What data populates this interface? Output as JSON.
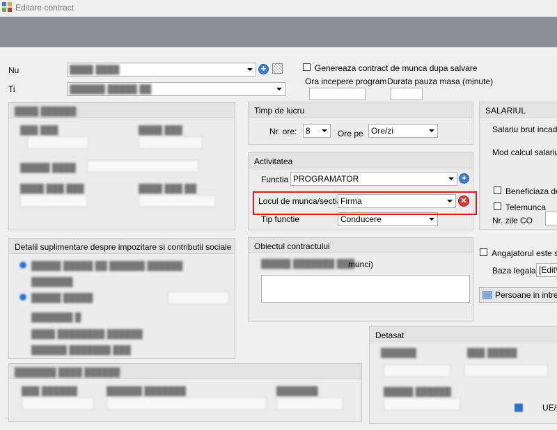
{
  "window": {
    "title": "Editare contract"
  },
  "top": {
    "name_label": "Nu",
    "type_label": "Ti",
    "generate_checkbox_label": "Genereaza contract de munca dupa salvare",
    "start_program_label": "Ora incepere program",
    "lunch_break_label": "Durata pauza masa (minute)",
    "start_program_value": "",
    "lunch_break_value": ""
  },
  "timp_lucru": {
    "title": "Timp de lucru",
    "hours_label": "Nr. ore:",
    "hours_value": "8",
    "per_label": "Ore pe",
    "per_value": "Ore/zi"
  },
  "activitatea": {
    "title": "Activitatea",
    "functia_label": "Functia",
    "functia_value": "PROGRAMATOR",
    "locul_label": "Locul de munca/sectia",
    "locul_value": "Firma",
    "tip_functie_label": "Tip functie",
    "tip_functie_value": "Conducere"
  },
  "obiectul": {
    "title": "Obiectul contractului",
    "partial_text": "munci)"
  },
  "salariul": {
    "title": "SALARIUL",
    "salariu_brut_label": "Salariu brut incadra",
    "mod_calcul_label": "Mod calcul salariu",
    "beneficiaza_label": "Beneficiaza de t",
    "telemunca_label": "Telemunca",
    "zile_co_label": "Nr. zile CO"
  },
  "angajator": {
    "checkbox_label": "Angajatorul este scu",
    "baza_legala_label": "Baza legala",
    "baza_legala_value": "[Edit\\",
    "persoane_button": "Persoane in intretin"
  },
  "detalii": {
    "title": "Detalii suplimentare despre impozitare si contributii sociale"
  },
  "detasat": {
    "title": "Detasat",
    "partial_text": "UE/C"
  }
}
